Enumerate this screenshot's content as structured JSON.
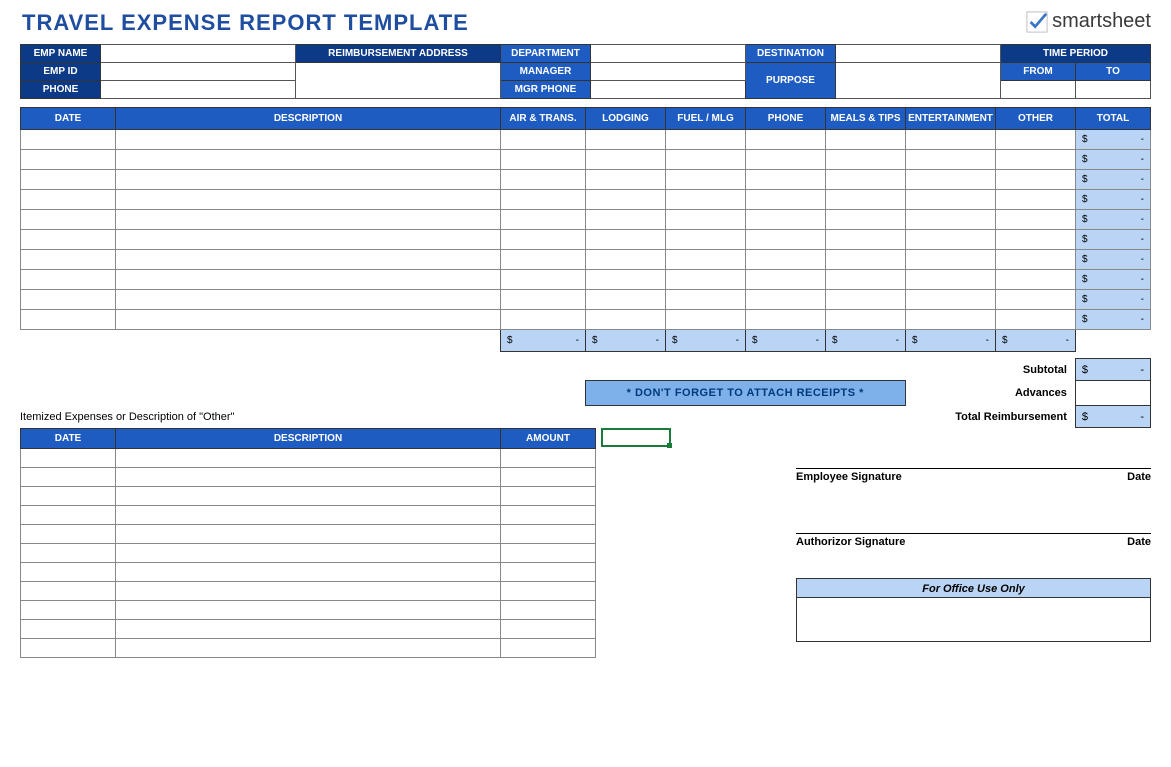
{
  "title": "TRAVEL EXPENSE REPORT TEMPLATE",
  "logo_text": "smartsheet",
  "info": {
    "emp_name": "EMP NAME",
    "emp_id": "EMP ID",
    "phone": "PHONE",
    "reimb_addr": "REIMBURSEMENT ADDRESS",
    "department": "DEPARTMENT",
    "manager": "MANAGER",
    "mgr_phone": "MGR PHONE",
    "destination": "DESTINATION",
    "purpose": "PURPOSE",
    "time_period": "TIME PERIOD",
    "from": "FROM",
    "to": "TO"
  },
  "exp_headers": [
    "DATE",
    "DESCRIPTION",
    "AIR & TRANS.",
    "LODGING",
    "FUEL / MLG",
    "PHONE",
    "MEALS & TIPS",
    "ENTERTAINMENT",
    "OTHER",
    "TOTAL"
  ],
  "row_total_display": {
    "dollar": "$",
    "dash": "-"
  },
  "col_total_display": {
    "dollar": "$",
    "dash": "-"
  },
  "reminder": "* DON'T FORGET TO ATTACH RECEIPTS *",
  "summary": {
    "subtotal_label": "Subtotal",
    "advances_label": "Advances",
    "reimb_label": "Total Reimbursement"
  },
  "itemized_title": "Itemized Expenses or Description of \"Other\"",
  "item_headers": [
    "DATE",
    "DESCRIPTION",
    "AMOUNT"
  ],
  "sig": {
    "emp": "Employee Signature",
    "auth": "Authorizor Signature",
    "date": "Date"
  },
  "office": "For Office Use Only"
}
